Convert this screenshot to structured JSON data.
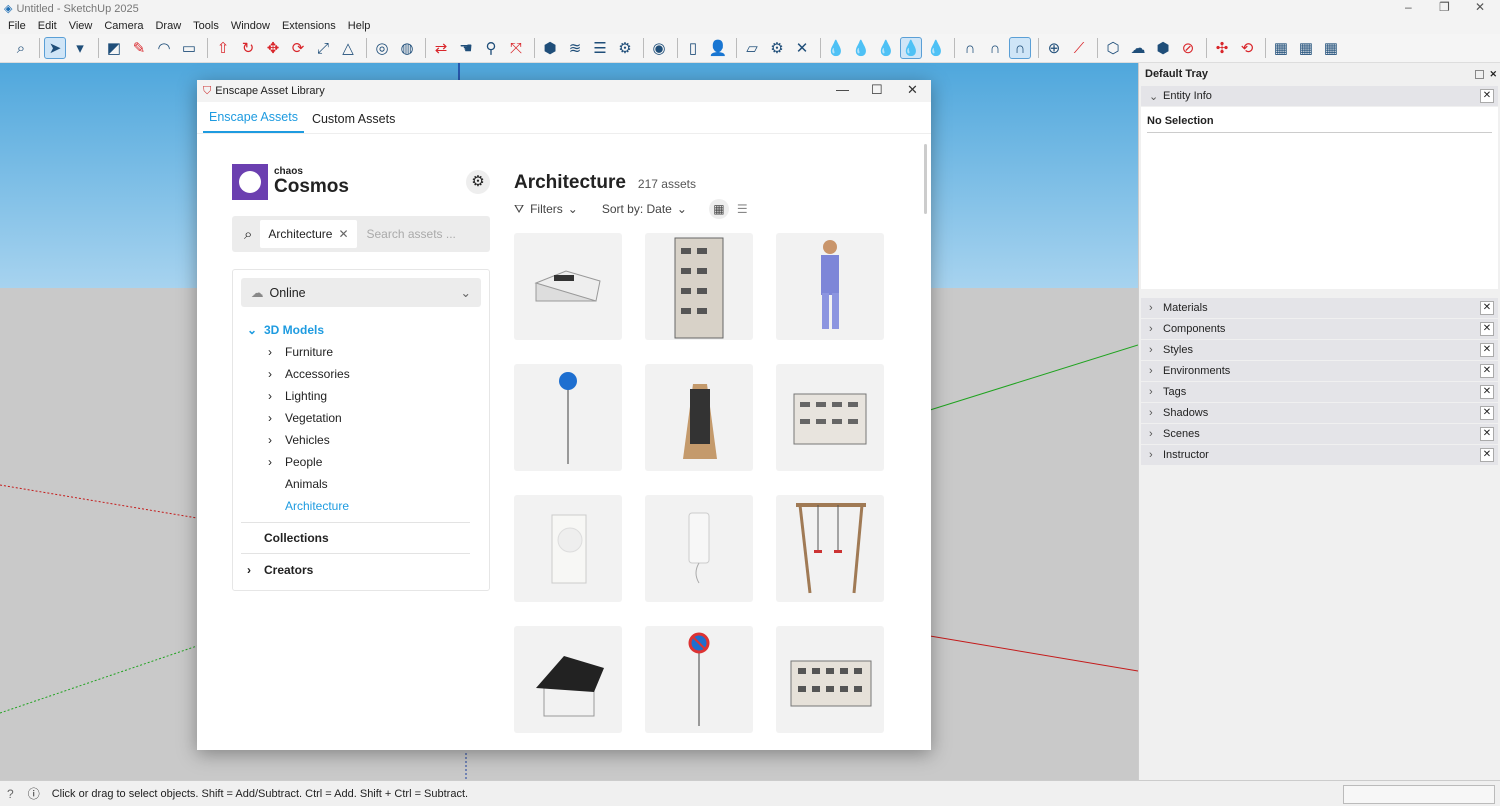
{
  "window": {
    "title": "Untitled - SketchUp 2025",
    "minimize": "–",
    "restore": "❐",
    "close": "✕"
  },
  "menu": [
    "File",
    "Edit",
    "View",
    "Camera",
    "Draw",
    "Tools",
    "Window",
    "Extensions",
    "Help"
  ],
  "toolbar": [
    {
      "name": "zoom-icon",
      "g": "⌕"
    },
    {
      "sep": 1
    },
    {
      "name": "select-icon",
      "g": "➤",
      "sel": 1
    },
    {
      "name": "dropdown-arrow-icon",
      "g": "▾"
    },
    {
      "sep": 1
    },
    {
      "name": "eraser-icon",
      "g": "◩"
    },
    {
      "name": "pencil-icon",
      "g": "✎",
      "red": 1
    },
    {
      "name": "arc-icon",
      "g": "◠"
    },
    {
      "name": "rectangle-icon",
      "g": "▭"
    },
    {
      "sep": 1
    },
    {
      "name": "push-pull-icon",
      "g": "⇧",
      "red": 1
    },
    {
      "name": "follow-me-icon",
      "g": "↻",
      "red": 1
    },
    {
      "name": "move-icon",
      "g": "✥",
      "red": 1
    },
    {
      "name": "rotate-icon",
      "g": "⟳",
      "red": 1
    },
    {
      "name": "scale-icon",
      "g": "⤢"
    },
    {
      "name": "flip-icon",
      "g": "△"
    },
    {
      "sep": 1
    },
    {
      "name": "tape-measure-icon",
      "g": "◎"
    },
    {
      "name": "paint-bucket-icon",
      "g": "◍"
    },
    {
      "sep": 1
    },
    {
      "name": "orbit-icon",
      "g": "⇄",
      "red": 1
    },
    {
      "name": "pan-icon",
      "g": "☚"
    },
    {
      "name": "zoom-tool-icon",
      "g": "⚲"
    },
    {
      "name": "zoom-extents-icon",
      "g": "⤧",
      "red": 1
    },
    {
      "sep": 1
    },
    {
      "name": "warehouse-icon",
      "g": "⬢"
    },
    {
      "name": "extension-warehouse-icon",
      "g": "≋"
    },
    {
      "name": "layers-icon",
      "g": "☰"
    },
    {
      "name": "extension-manager-icon",
      "g": "⚙"
    },
    {
      "sep": 1
    },
    {
      "name": "account-icon",
      "g": "◉"
    },
    {
      "sep": 1
    },
    {
      "name": "new-file-icon",
      "g": "▯"
    },
    {
      "name": "add-user-icon",
      "g": "👤"
    },
    {
      "sep": 1
    },
    {
      "name": "folder-icon",
      "g": "▱"
    },
    {
      "name": "settings-icon",
      "g": "⚙"
    },
    {
      "name": "close-tool-icon",
      "g": "✕"
    },
    {
      "sep": 1
    },
    {
      "name": "drop-outline-icon",
      "g": "💧"
    },
    {
      "name": "drop-half-icon",
      "g": "💧"
    },
    {
      "name": "drop-full-icon",
      "g": "💧"
    },
    {
      "name": "drop-selected-icon",
      "g": "💧",
      "sel": 1
    },
    {
      "name": "drop-dotted-icon",
      "g": "💧"
    },
    {
      "sep": 1
    },
    {
      "name": "magnet-off-icon",
      "g": "∩"
    },
    {
      "name": "magnet-icon",
      "g": "∩"
    },
    {
      "name": "magnet-selected-icon",
      "g": "∩",
      "sel": 1
    },
    {
      "sep": 1
    },
    {
      "name": "add-circle-icon",
      "g": "⊕"
    },
    {
      "name": "connect-icon",
      "g": "⟋",
      "red": 1
    },
    {
      "sep": 1
    },
    {
      "name": "cube-icon",
      "g": "⬡"
    },
    {
      "name": "cloud-icon",
      "g": "☁"
    },
    {
      "name": "box-icon",
      "g": "⬢"
    },
    {
      "name": "no-box-icon",
      "g": "⊘",
      "red": 1
    },
    {
      "sep": 1
    },
    {
      "name": "explode-icon",
      "g": "✣",
      "red": 1
    },
    {
      "name": "refresh-icon",
      "g": "⟲",
      "red": 1
    },
    {
      "sep": 1
    },
    {
      "name": "grid-1-icon",
      "g": "▦"
    },
    {
      "name": "grid-2-icon",
      "g": "▦"
    },
    {
      "name": "grid-3-icon",
      "g": "▦"
    }
  ],
  "dialog": {
    "title": "Enscape Asset Library",
    "min": "—",
    "max": "☐",
    "close": "✕",
    "tabs": [
      "Enscape Assets",
      "Custom Assets"
    ],
    "brand_small": "chaos",
    "brand_large": "Cosmos",
    "search_chip": "Architecture",
    "search_placeholder": "Search assets ...",
    "source": "Online",
    "section": "3D Models",
    "categories": [
      {
        "label": "Furniture",
        "exp": true
      },
      {
        "label": "Accessories",
        "exp": true
      },
      {
        "label": "Lighting",
        "exp": true
      },
      {
        "label": "Vegetation",
        "exp": true
      },
      {
        "label": "Vehicles",
        "exp": true
      },
      {
        "label": "People",
        "exp": true
      },
      {
        "label": "Animals",
        "exp": false
      },
      {
        "label": "Architecture",
        "exp": false,
        "active": true
      }
    ],
    "collections": "Collections",
    "creators": "Creators",
    "heading": "Architecture",
    "count": "217 assets",
    "filters": "Filters",
    "sort": "Sort by: Date",
    "assets": [
      "house-flat-roof-solar",
      "apartment-tower",
      "worker-in-overalls",
      "blue-arrow-sign",
      "chalkboard-a-frame-sign",
      "apartment-block",
      "wall-speaker",
      "wall-intercom",
      "wooden-swing-set",
      "house-solar-roof",
      "no-parking-sign",
      "residential-building"
    ]
  },
  "tray": {
    "title": "Default Tray",
    "entity_info": "Entity Info",
    "selection": "No Selection",
    "panels": [
      "Materials",
      "Components",
      "Styles",
      "Environments",
      "Tags",
      "Shadows",
      "Scenes",
      "Instructor"
    ]
  },
  "status": {
    "text": "Click or drag to select objects. Shift = Add/Subtract. Ctrl = Add. Shift + Ctrl = Subtract."
  }
}
